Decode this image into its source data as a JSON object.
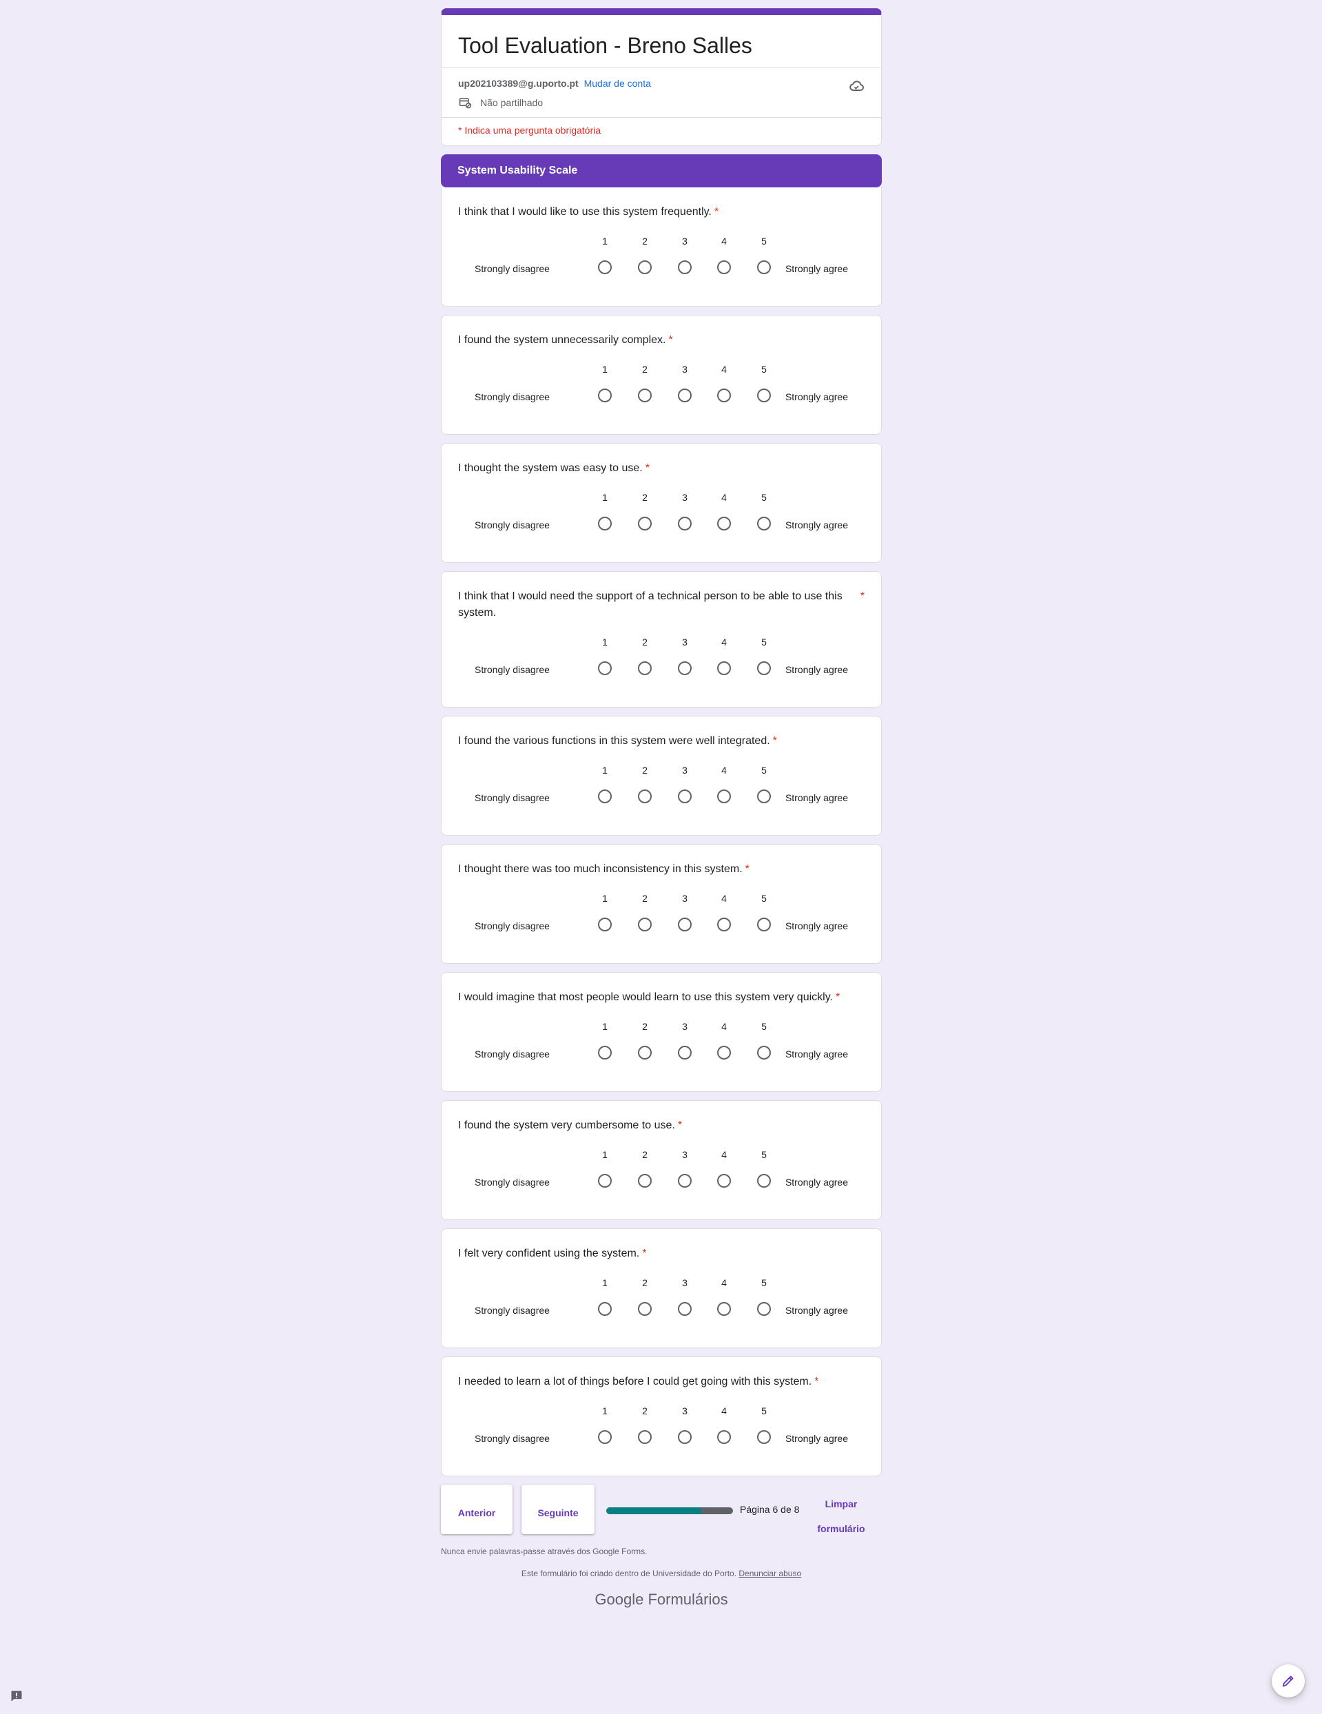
{
  "form": {
    "title": "Tool Evaluation - Breno Salles",
    "account_email": "up202103389@g.uporto.pt",
    "switch_account": "Mudar de conta",
    "not_shared": "Não partilhado",
    "required_note": "* Indica uma pergunta obrigatória"
  },
  "section": {
    "title": "System Usability Scale"
  },
  "scale": {
    "numbers": [
      "1",
      "2",
      "3",
      "4",
      "5"
    ],
    "low_label": "Strongly disagree",
    "high_label": "Strongly agree"
  },
  "questions": [
    {
      "text": "I think that I would like to use this system frequently.",
      "required": "*"
    },
    {
      "text": "I found the system unnecessarily complex.",
      "required": "*"
    },
    {
      "text": "I thought the system was easy to use.",
      "required": "*"
    },
    {
      "text": "I think that I would need the support of a technical person to be able to use this system.",
      "required": "*"
    },
    {
      "text": "I found the various functions in this system were well integrated.",
      "required": "*"
    },
    {
      "text": "I thought there was too much inconsistency in this system.",
      "required": "*"
    },
    {
      "text": "I would imagine that most people would learn to use this system very quickly.",
      "required": "*"
    },
    {
      "text": "I found the system very cumbersome to use.",
      "required": "*"
    },
    {
      "text": "I felt very confident using the system.",
      "required": "*"
    },
    {
      "text": "I needed to learn a lot of things before I could get going with this system.",
      "required": "*"
    }
  ],
  "nav": {
    "prev_label": "Anterior",
    "next_label": "Seguinte",
    "progress_fraction": 0.75,
    "progress_text": "Página 6 de 8",
    "clear_label_line1": "Limpar",
    "clear_label_line2": "formulário"
  },
  "footer": {
    "password_warning": "Nunca envie palavras-passe através dos Google Forms.",
    "created_text": "Este formulário foi criado dentro de Universidade do Porto.",
    "report_abuse": "Denunciar abuso",
    "brand_google": "Google",
    "brand_product": "Formulários"
  },
  "colors": {
    "accent": "#673ab7",
    "background": "#f0ebf8",
    "required": "#d93025",
    "link": "#1a73e8",
    "progress_fill": "#0b8080",
    "progress_track": "#5f6368"
  },
  "icons": {
    "cloud": "cloud-icon",
    "not_shared": "not-shared-icon",
    "feedback": "feedback-icon",
    "edit": "pencil-icon"
  }
}
